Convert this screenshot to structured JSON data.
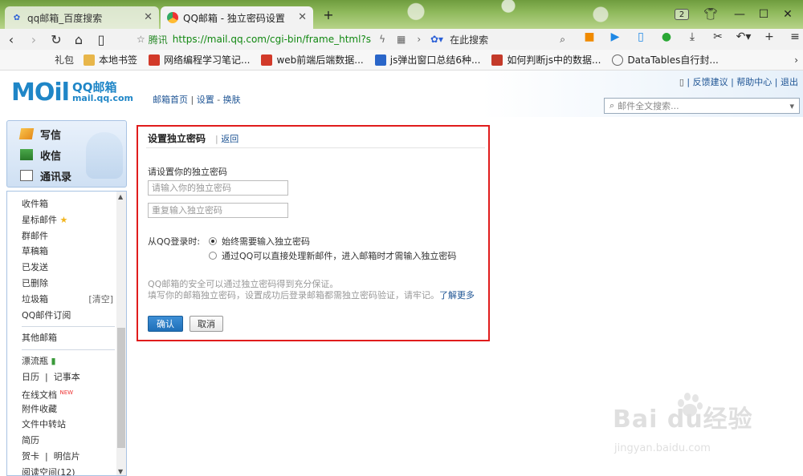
{
  "browser": {
    "tabs": [
      {
        "title": "qq邮箱_百度搜索",
        "active": false
      },
      {
        "title": "QQ邮箱 - 独立密码设置",
        "active": true
      }
    ],
    "tab_count": "2",
    "address": {
      "site_label": "腾讯",
      "url": "https://mail.qq.com/cgi-bin/frame_html?s",
      "search_placeholder": "在此搜索"
    },
    "bookmarks": [
      {
        "label": "礼包",
        "color": "transparent"
      },
      {
        "label": "本地书签",
        "color": "#e8b64a"
      },
      {
        "label": "网络编程学习笔记...",
        "color": "#d23a2a"
      },
      {
        "label": "web前端后端数据...",
        "color": "#d23a2a"
      },
      {
        "label": "js弹出窗口总结6种...",
        "color": "#2a66c9"
      },
      {
        "label": "如何判断js中的数据...",
        "color": "#c43a2a"
      },
      {
        "label": "DataTables自行封...",
        "color": "transparent"
      }
    ]
  },
  "mail_header": {
    "logo_text": "MOil",
    "brand_name": "QQ邮箱",
    "brand_domain": "mail.qq.com",
    "nav_home": "邮箱首页",
    "nav_settings": "设置",
    "nav_skin": "换肤",
    "top_feedback": "反馈建议",
    "top_help": "帮助中心",
    "top_logout": "退出",
    "search_placeholder": "邮件全文搜索..."
  },
  "sidebar": {
    "actions": [
      {
        "label": "写信"
      },
      {
        "label": "收信"
      },
      {
        "label": "通讯录"
      }
    ],
    "folders": [
      "收件箱",
      "星标邮件",
      "群邮件",
      "草稿箱",
      "已发送",
      "已删除",
      "垃圾箱",
      "QQ邮件订阅"
    ],
    "trash_clear": "[清空]",
    "other_mailbox": "其他邮箱",
    "apps": [
      "漂流瓶",
      "日历",
      "在线文档",
      "附件收藏",
      "文件中转站",
      "简历",
      "贺卡"
    ],
    "notebook": "记事本",
    "postcard": "明信片",
    "new_badge": "NEW",
    "cut_item": "阅读空间(12)"
  },
  "panel": {
    "title": "设置独立密码",
    "back": "返回",
    "prompt": "请设置你的独立密码",
    "password_placeholder": "请输入你的独立密码",
    "repeat_placeholder": "重复输入独立密码",
    "qq_login_label": "从QQ登录时:",
    "option_always": "始终需要输入独立密码",
    "option_qq": "通过QQ可以直接处理新邮件，进入邮箱时才需输入独立密码",
    "note_line1": "QQ邮箱的安全可以通过独立密码得到充分保证。",
    "note_line2": "填写你的邮箱独立密码，设置成功后登录邮箱都需独立密码验证，请牢记。",
    "learn_more": "了解更多",
    "ok": "确认",
    "cancel": "取消"
  },
  "watermark": {
    "brand": "Bai du经验",
    "url": "jingyan.baidu.com"
  }
}
